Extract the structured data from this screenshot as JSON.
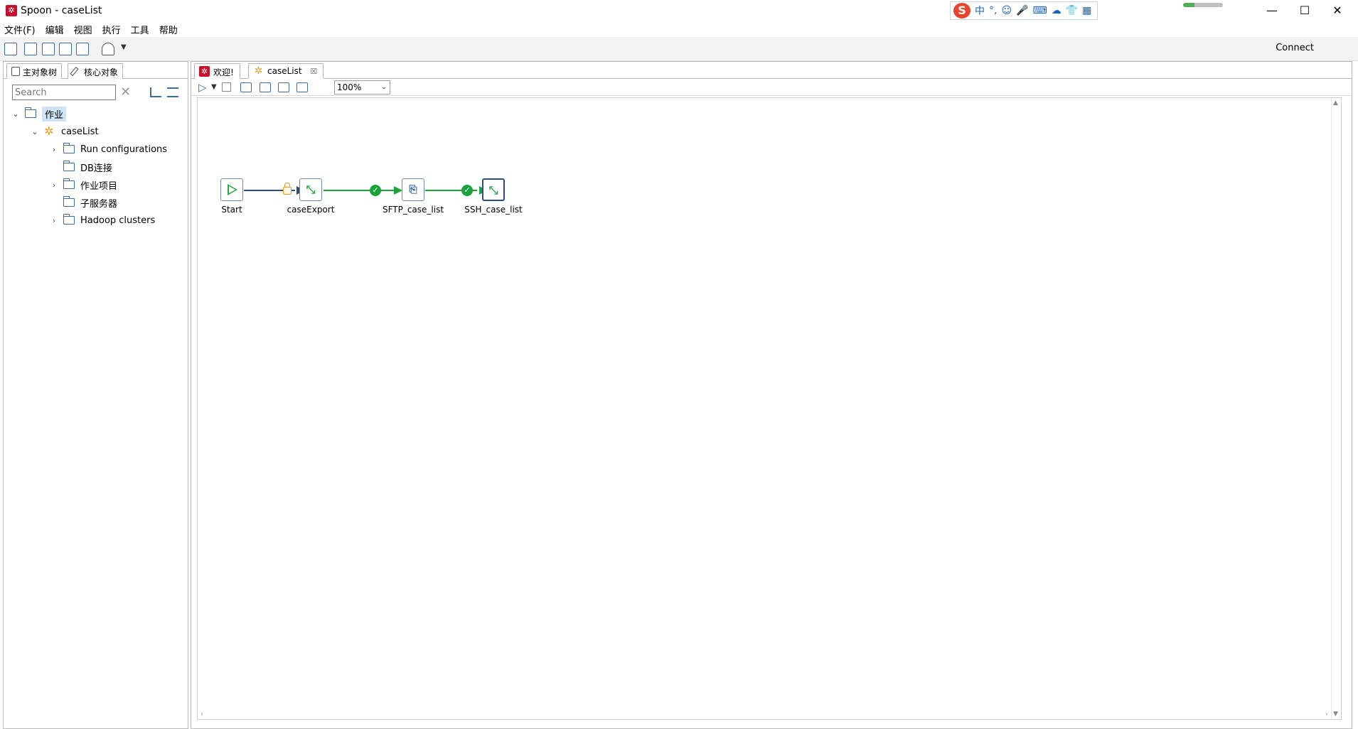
{
  "window": {
    "title": "Spoon - caseList",
    "app_icon": "spoon-icon",
    "controls": {
      "minimize": "—",
      "maximize": "☐",
      "close": "✕"
    }
  },
  "ime": {
    "logo": "S",
    "items": [
      "中",
      "°,",
      "☺",
      "🎤",
      "⌨",
      "☁",
      "👕",
      "▦"
    ]
  },
  "menu": {
    "items": [
      "文件(F)",
      "编辑",
      "视图",
      "执行",
      "工具",
      "帮助"
    ]
  },
  "toolbar": {
    "icons": [
      "new-file-icon",
      "open-folder-icon",
      "explore-icon",
      "save-icon",
      "save-as-icon",
      "layers-icon"
    ],
    "connect_label": "Connect"
  },
  "left_panel": {
    "tabs": [
      "主对象树",
      "核心对象"
    ],
    "search_placeholder": "Search",
    "tree": {
      "root": "作业",
      "job": "caseList",
      "children": [
        "Run configurations",
        "DB连接",
        "作业项目",
        "子服务器",
        "Hadoop clusters"
      ]
    }
  },
  "editor": {
    "tabs": [
      {
        "label": "欢迎!",
        "icon": "spoon-icon"
      },
      {
        "label": "caseList",
        "icon": "job-icon",
        "closable": true
      }
    ],
    "zoom": "100%"
  },
  "job_graph": {
    "nodes": [
      "Start",
      "caseExport",
      "SFTP_case_list",
      "SSH_case_list"
    ],
    "hops": [
      {
        "from": "Start",
        "to": "caseExport",
        "type": "unconditional"
      },
      {
        "from": "caseExport",
        "to": "SFTP_case_list",
        "type": "success"
      },
      {
        "from": "SFTP_case_list",
        "to": "SSH_case_list",
        "type": "success"
      }
    ],
    "colors": {
      "success": "#1aa33a",
      "unconditional": "#e89a1c",
      "hop_line": "#2b4e7a"
    }
  }
}
